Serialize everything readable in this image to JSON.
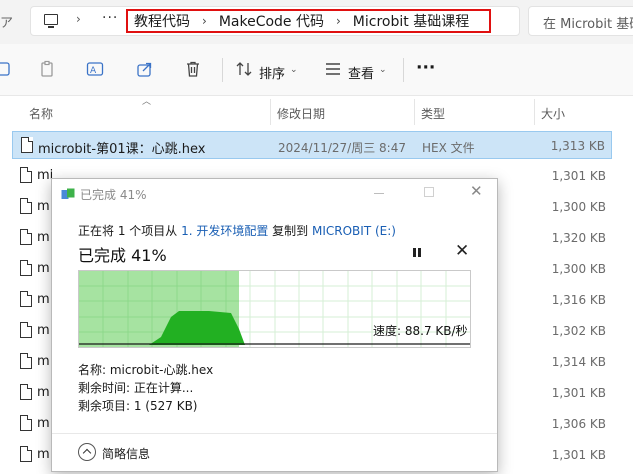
{
  "address_bar": {
    "more": "···",
    "crumbs": [
      "教程代码",
      "MakeCode 代码",
      "Microbit 基础课程"
    ],
    "search_placeholder": "在 Microbit 基础课程 中搜索"
  },
  "toolbar": {
    "sort_label": "排序",
    "view_label": "查看",
    "more_label": "···"
  },
  "columns": {
    "name": "名称",
    "date": "修改日期",
    "type": "类型",
    "size": "大小"
  },
  "files": [
    {
      "name": "microbit-第01课：心跳.hex",
      "date": "2024/11/27/周三 8:47",
      "type": "HEX 文件",
      "size": "1,313 KB"
    },
    {
      "name": "mi",
      "date": "",
      "type": "",
      "size": "1,301 KB"
    },
    {
      "name": "m",
      "date": "",
      "type": "",
      "size": "1,300 KB"
    },
    {
      "name": "m",
      "date": "",
      "type": "",
      "size": "1,320 KB"
    },
    {
      "name": "m",
      "date": "",
      "type": "",
      "size": "1,300 KB"
    },
    {
      "name": "m",
      "date": "",
      "type": "",
      "size": "1,316 KB"
    },
    {
      "name": "m",
      "date": "",
      "type": "",
      "size": "1,302 KB"
    },
    {
      "name": "m",
      "date": "",
      "type": "",
      "size": "1,314 KB"
    },
    {
      "name": "m",
      "date": "",
      "type": "",
      "size": "1,301 KB"
    },
    {
      "name": "m",
      "date": "",
      "type": "",
      "size": "1,306 KB"
    },
    {
      "name": "m",
      "date": "",
      "type": "",
      "size": "1,301 KB"
    }
  ],
  "dialog": {
    "title": "已完成 41%",
    "copy_prefix": "正在将 1 个项目从 ",
    "source": "1. 开发环境配置",
    "copy_mid": " 复制到 ",
    "destination": "MICROBIT (E:)",
    "percent_text": "已完成 41%",
    "progress": 0.41,
    "speed": "速度: 88.7 KB/秒",
    "name_line": "名称: microbit-心跳.hex",
    "time_line": "剩余时间: 正在计算...",
    "items_line": "剩余项目: 1 (527 KB)",
    "details_label": "简略信息",
    "colors": {
      "progress_fill": "#a6e3a1",
      "graph_fill": "#22b022",
      "grid": "#8dd88a"
    }
  },
  "icons": {
    "nav_pc": "computer-icon",
    "copy": "copy-icon",
    "paste": "paste-icon",
    "rename": "rename-icon",
    "share": "share-icon",
    "delete": "trash-icon",
    "sort": "sort-icon",
    "view": "view-icon"
  }
}
